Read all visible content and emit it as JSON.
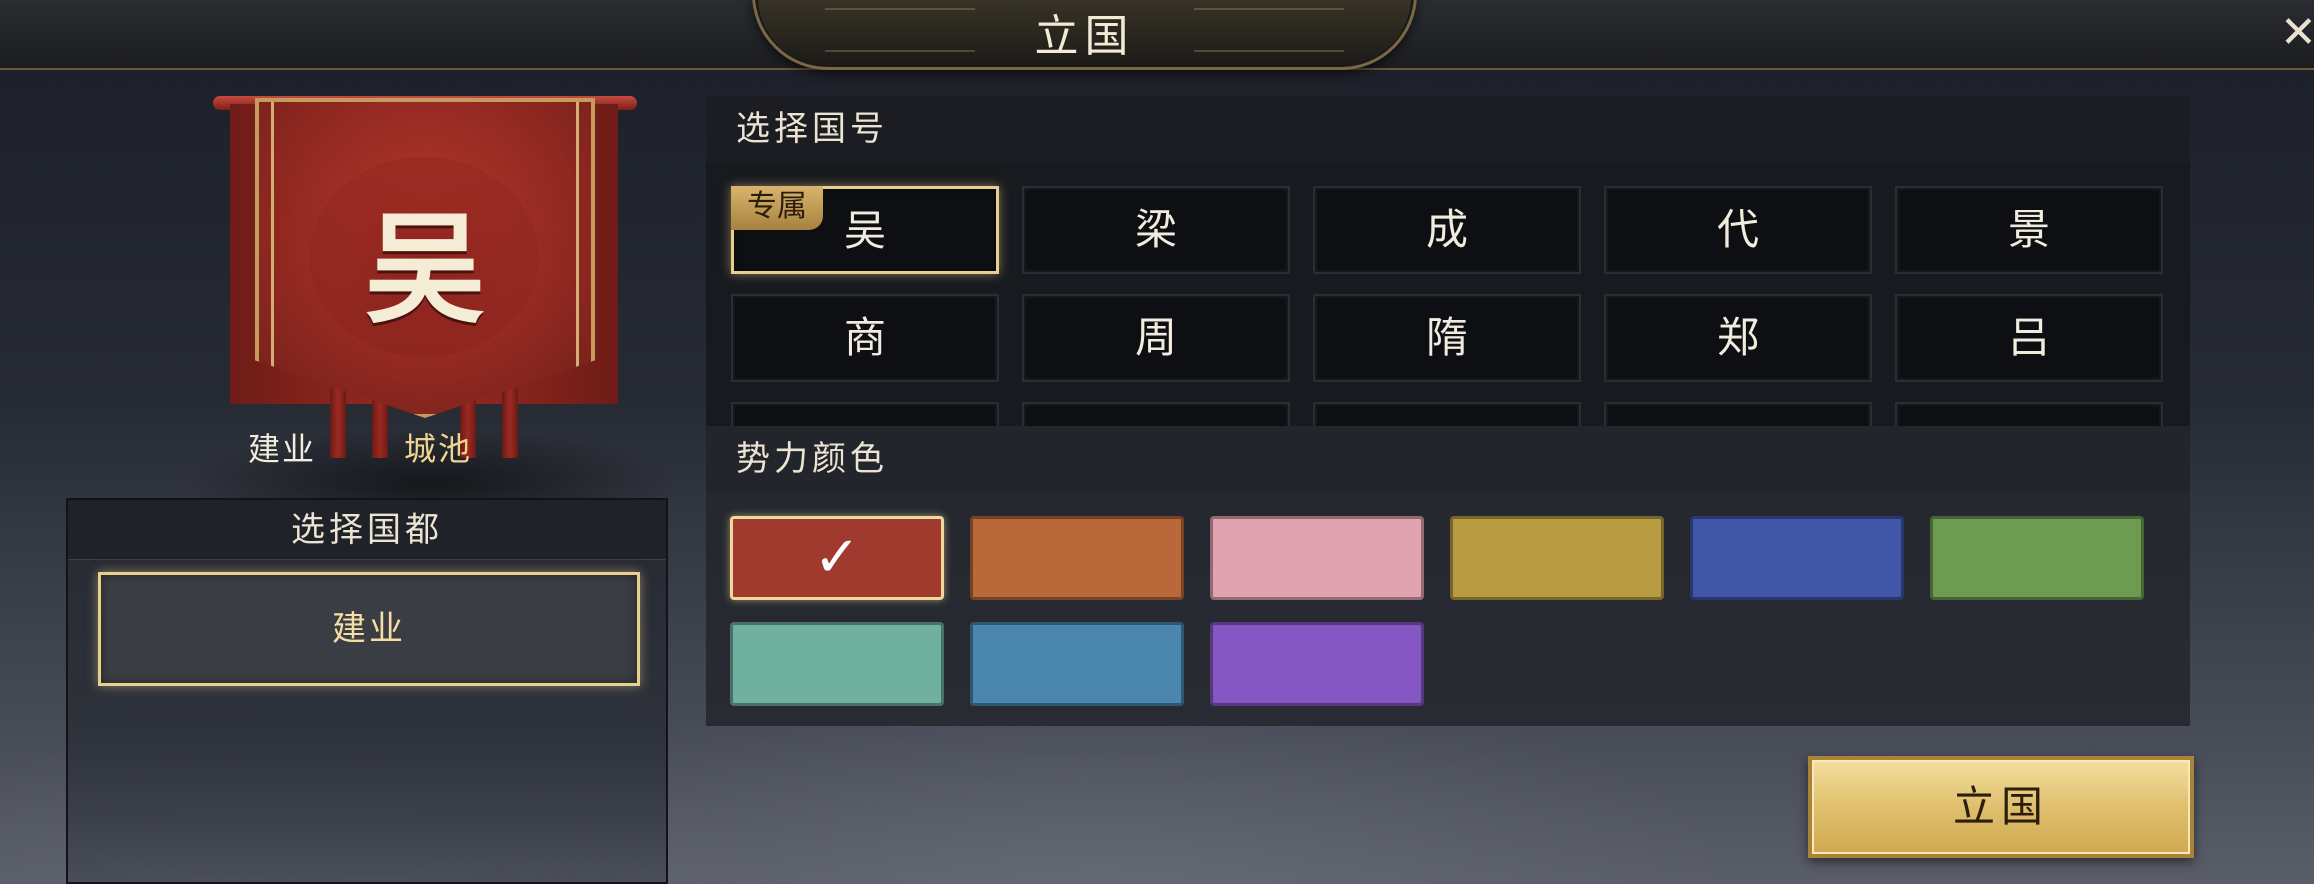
{
  "header": {
    "title": "立国"
  },
  "close_icon": "close-x-icon",
  "banner": {
    "char": "吴",
    "city_name": "建业",
    "city_type": "城池"
  },
  "capital": {
    "header": "选择国都",
    "options": [
      "建业"
    ],
    "selected": "建业"
  },
  "name_section": {
    "header": "选择国号",
    "exclusive_tag": "专属",
    "names": [
      "吴",
      "梁",
      "成",
      "代",
      "景",
      "商",
      "周",
      "隋",
      "郑",
      "吕"
    ],
    "selected": "吴"
  },
  "color_section": {
    "header": "势力颜色",
    "colors": [
      "#a03a2e",
      "#b9683a",
      "#e2a3b1",
      "#b89c42",
      "#3f57a6",
      "#6e9b52",
      "#6fb09f",
      "#4b86ae",
      "#8457c2"
    ],
    "selected_index": 0
  },
  "confirm": {
    "label": "立国"
  }
}
